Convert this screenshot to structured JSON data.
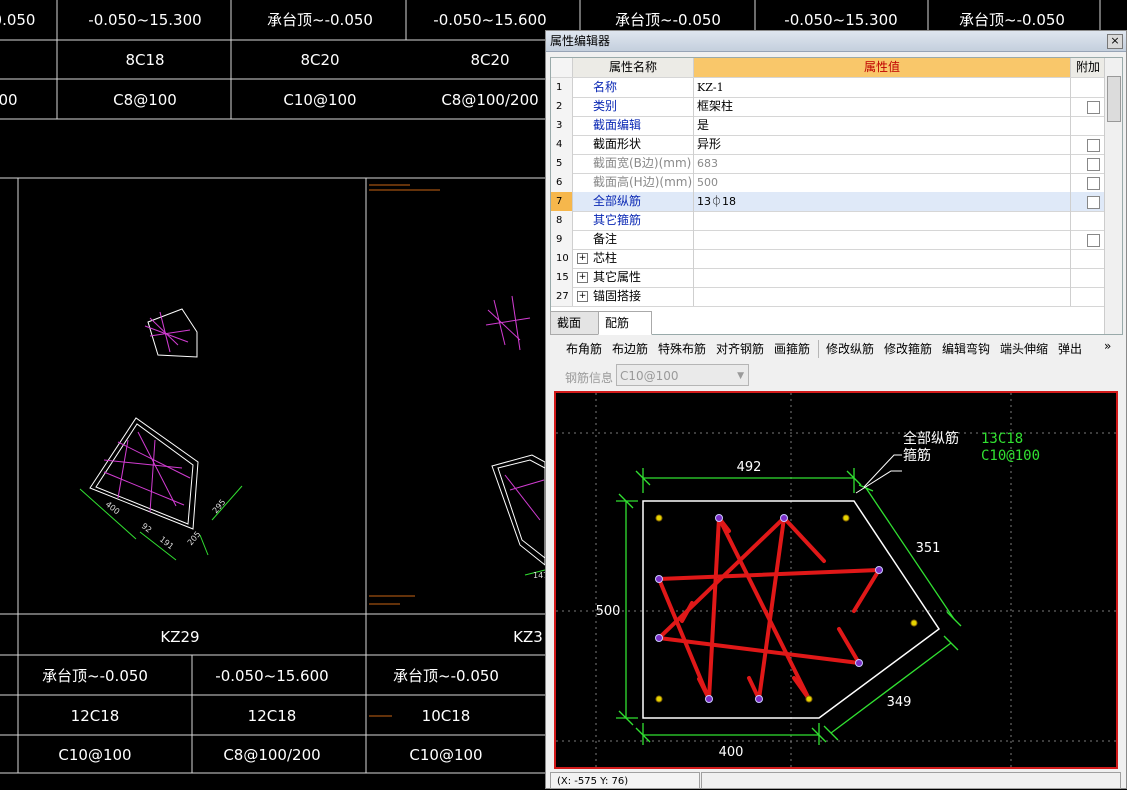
{
  "cad_table": {
    "top_row": [
      "0.050",
      "-0.050~15.300",
      "承台顶~-0.050",
      "-0.050~15.600",
      "承台顶~-0.050",
      "-0.050~15.300",
      "承台顶~-0.050"
    ],
    "row2": [
      "8C18",
      "8C20",
      "8C20"
    ],
    "row3": [
      "00",
      "C8@100",
      "C10@100",
      "C8@100/200"
    ],
    "column_labels": [
      "KZ29",
      "KZ3"
    ],
    "bottom_rows": [
      [
        "承台顶~-0.050",
        "-0.050~15.600",
        "承台顶~-0.050"
      ],
      [
        "12C18",
        "12C18",
        "10C18"
      ],
      [
        "C10@100",
        "C8@100/200",
        "C10@100"
      ]
    ],
    "dims_left": [
      "400",
      "92",
      "191",
      "205",
      "295"
    ],
    "dims_right": [
      "147"
    ]
  },
  "editor": {
    "title": "属性编辑器",
    "close": "×",
    "header": {
      "name": "属性名称",
      "value": "属性值",
      "add": "附加"
    },
    "rows": [
      {
        "num": "1",
        "name": "名称",
        "value": "KZ-1"
      },
      {
        "num": "2",
        "name": "类别",
        "value": "框架柱"
      },
      {
        "num": "3",
        "name": "截面编辑",
        "value": "是"
      },
      {
        "num": "4",
        "name": "截面形状",
        "value": "异形"
      },
      {
        "num": "5",
        "name": "截面宽(B边)(mm)",
        "value": "683"
      },
      {
        "num": "6",
        "name": "截面高(H边)(mm)",
        "value": "500"
      },
      {
        "num": "7",
        "name": "全部纵筋",
        "value": "13⏀18"
      },
      {
        "num": "8",
        "name": "其它箍筋",
        "value": ""
      },
      {
        "num": "9",
        "name": "备注",
        "value": ""
      },
      {
        "num": "10",
        "name": "芯柱",
        "value": ""
      },
      {
        "num": "15",
        "name": "其它属性",
        "value": ""
      },
      {
        "num": "27",
        "name": "锚固搭接",
        "value": ""
      }
    ],
    "tabs": [
      "截面",
      "配筋"
    ],
    "toolbar": [
      "布角筋",
      "布边筋",
      "特殊布筋",
      "对齐钢筋",
      "画箍筋",
      "修改纵筋",
      "修改箍筋",
      "编辑弯钩",
      "端头伸缩",
      "弹出"
    ],
    "toolbar_more": "»",
    "rebar_info_label": "钢筋信息",
    "rebar_info_value": "C10@100",
    "status": "(X: -575 Y: 76)"
  },
  "preview": {
    "dims": [
      "492",
      "351",
      "500",
      "349",
      "400"
    ],
    "label_all_bars": "全部纵筋",
    "label_stirrup": "箍筋",
    "value_all_bars": "13C18",
    "value_stirrup": "C10@100"
  }
}
